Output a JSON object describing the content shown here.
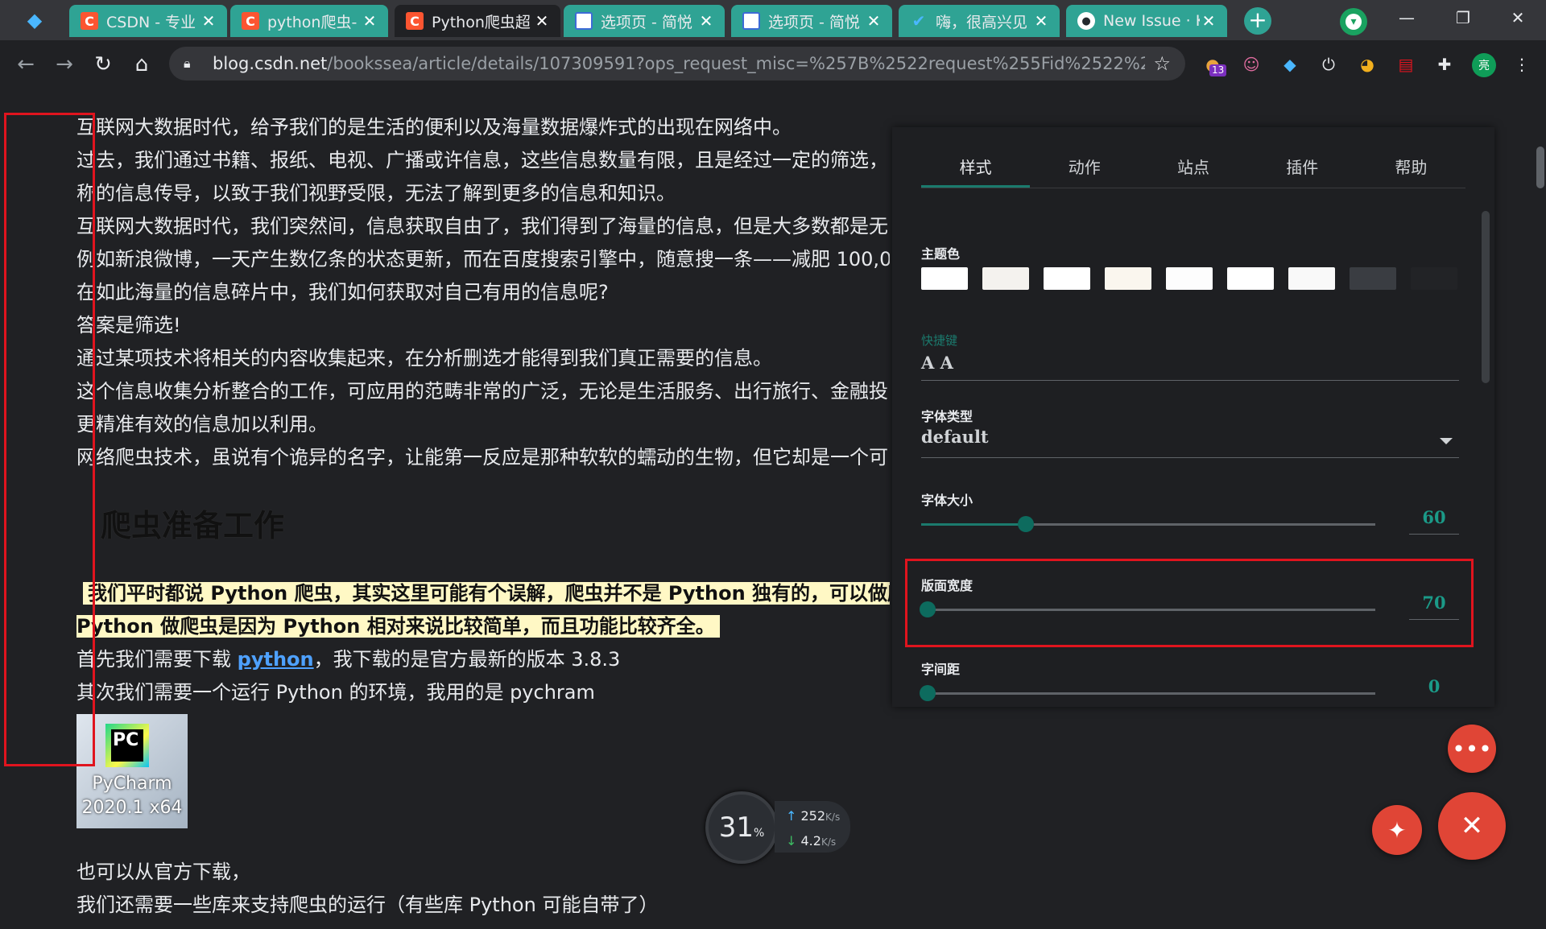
{
  "tabs": [
    {
      "title": "CSDN - 专业",
      "favicon": "csdn-icon",
      "active": false
    },
    {
      "title": "python爬虫-",
      "favicon": "csdn-icon",
      "active": false
    },
    {
      "title": "Python爬虫超",
      "favicon": "csdn-icon",
      "active": true
    },
    {
      "title": "选项页 - 简悦",
      "favicon": "document-icon",
      "active": false
    },
    {
      "title": "选项页 - 简悦",
      "favicon": "document-icon",
      "active": false
    },
    {
      "title": "嗨，很高兴见",
      "favicon": "check-icon",
      "active": false
    },
    {
      "title": "New Issue · K",
      "favicon": "github-icon",
      "active": false
    }
  ],
  "toolbar": {
    "url_host": "blog.csdn.net",
    "url_rest": "/bookssea/article/details/107309591?ops_request_misc=%257B%2522request%255Fid%2522%253...",
    "ext_badge": "13",
    "profile_initial": "亮"
  },
  "article": {
    "paragraphs": [
      "互联网大数据时代，给予我们的是生活的便利以及海量数据爆炸式的出现在网络中。",
      "过去，我们通过书籍、报纸、电视、广播或许信息，这些信息数量有限，且是经过一定的筛选，",
      "称的信息传导，以致于我们视野受限，无法了解到更多的信息和知识。",
      "互联网大数据时代，我们突然间，信息获取自由了，我们得到了海量的信息，但是大多数都是无",
      "例如新浪微博，一天产生数亿条的状态更新，而在百度搜索引擎中，随意搜一条——减肥 100,0",
      "在如此海量的信息碎片中，我们如何获取对自己有用的信息呢?",
      "答案是筛选!",
      "通过某项技术将相关的内容收集起来，在分析删选才能得到我们真正需要的信息。",
      "这个信息收集分析整合的工作，可应用的范畴非常的广泛，无论是生活服务、出行旅行、金融投",
      "更精准有效的信息加以利用。",
      "网络爬虫技术，虽说有个诡异的名字，让能第一反应是那种软软的蠕动的生物，但它却是一个可"
    ],
    "heading": "爬虫准备工作",
    "highlight_1": "我们平时都说 Python 爬虫，其实这里可能有个误解，爬虫并不是 Python 独有的，可以做爬",
    "highlight_2": "Python 做爬虫是因为 Python 相对来说比较简单，而且功能比较齐全。",
    "download_pre": "首先我们需要下载 ",
    "download_link": "python",
    "download_post": "，我下载的是官方最新的版本 3.8.3",
    "env_line": "其次我们需要一个运行 Python 的环境，我用的是 pychram",
    "image_logo": "PC",
    "image_caption_1": "PyCharm",
    "image_caption_2": "2020.1 x64",
    "tail_1": "也可以从官方下载，",
    "tail_2": "我们还需要一些库来支持爬虫的运行（有些库 Python 可能自带了）"
  },
  "speed_widget": {
    "percent": "31",
    "percent_unit": "%",
    "up": "252",
    "down": "4.2",
    "unit": "K/s"
  },
  "settings": {
    "tabs": [
      "样式",
      "动作",
      "站点",
      "插件",
      "帮助"
    ],
    "active_tab": 0,
    "theme_label": "主题色",
    "theme_colors": [
      "#ffffff",
      "#f4f2ee",
      "#ffffff",
      "#faf6ee",
      "#fdfdfd",
      "#ffffff",
      "#f9f9f9",
      "#3a3d42",
      "#222326"
    ],
    "shortcut_label": "快捷键",
    "shortcut_value": "A A",
    "font_type_label": "字体类型",
    "font_type_value": "default",
    "font_size_label": "字体大小",
    "font_size_value": "60",
    "font_size_fraction": 0.23,
    "width_label": "版面宽度",
    "width_value": "70",
    "width_fraction": 0.015,
    "spacing_label": "字间距",
    "spacing_value": "0",
    "spacing_fraction": 0.015
  },
  "colors": {
    "accent": "#1b7a6d",
    "tab_bg": "#2fa394",
    "fab": "#e04536",
    "annotation": "#e0141e"
  }
}
